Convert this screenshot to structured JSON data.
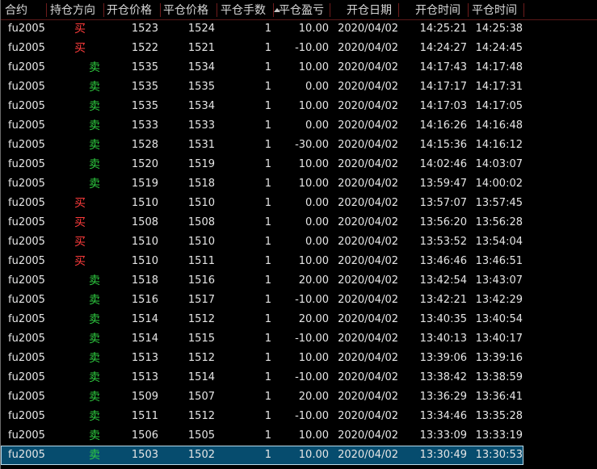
{
  "headers": {
    "contract": "合约",
    "direction": "持仓方向",
    "open_price": "开仓价格",
    "close_price": "平仓价格",
    "quantity": "平仓手数",
    "pnl": "平仓盈亏",
    "date": "开仓日期",
    "open_time": "开仓时间",
    "close_time": "平仓时间"
  },
  "colors": {
    "buy": "#ff3c3c",
    "sell": "#2ecc40",
    "selection": "#064c6e",
    "header_separator": "#6e1c1c"
  },
  "sort": {
    "column": "平仓盈亏",
    "icon": "sort-up-arrow-icon"
  },
  "rows": [
    {
      "contract": "fu2005",
      "direction": "买",
      "side": "buy",
      "open_price": "1523",
      "close_price": "1524",
      "quantity": "1",
      "pnl": "10.00",
      "date": "2020/04/02",
      "open_time": "14:25:21",
      "close_time": "14:25:38"
    },
    {
      "contract": "fu2005",
      "direction": "买",
      "side": "buy",
      "open_price": "1522",
      "close_price": "1521",
      "quantity": "1",
      "pnl": "-10.00",
      "date": "2020/04/02",
      "open_time": "14:24:27",
      "close_time": "14:24:45"
    },
    {
      "contract": "fu2005",
      "direction": "卖",
      "side": "sell",
      "open_price": "1535",
      "close_price": "1534",
      "quantity": "1",
      "pnl": "10.00",
      "date": "2020/04/02",
      "open_time": "14:17:43",
      "close_time": "14:17:48"
    },
    {
      "contract": "fu2005",
      "direction": "卖",
      "side": "sell",
      "open_price": "1535",
      "close_price": "1535",
      "quantity": "1",
      "pnl": "0.00",
      "date": "2020/04/02",
      "open_time": "14:17:17",
      "close_time": "14:17:31"
    },
    {
      "contract": "fu2005",
      "direction": "卖",
      "side": "sell",
      "open_price": "1535",
      "close_price": "1534",
      "quantity": "1",
      "pnl": "10.00",
      "date": "2020/04/02",
      "open_time": "14:17:03",
      "close_time": "14:17:05"
    },
    {
      "contract": "fu2005",
      "direction": "卖",
      "side": "sell",
      "open_price": "1533",
      "close_price": "1533",
      "quantity": "1",
      "pnl": "0.00",
      "date": "2020/04/02",
      "open_time": "14:16:26",
      "close_time": "14:16:48"
    },
    {
      "contract": "fu2005",
      "direction": "卖",
      "side": "sell",
      "open_price": "1528",
      "close_price": "1531",
      "quantity": "1",
      "pnl": "-30.00",
      "date": "2020/04/02",
      "open_time": "14:15:36",
      "close_time": "14:16:12"
    },
    {
      "contract": "fu2005",
      "direction": "卖",
      "side": "sell",
      "open_price": "1520",
      "close_price": "1519",
      "quantity": "1",
      "pnl": "10.00",
      "date": "2020/04/02",
      "open_time": "14:02:46",
      "close_time": "14:03:07"
    },
    {
      "contract": "fu2005",
      "direction": "卖",
      "side": "sell",
      "open_price": "1519",
      "close_price": "1518",
      "quantity": "1",
      "pnl": "10.00",
      "date": "2020/04/02",
      "open_time": "13:59:47",
      "close_time": "14:00:02"
    },
    {
      "contract": "fu2005",
      "direction": "买",
      "side": "buy",
      "open_price": "1510",
      "close_price": "1510",
      "quantity": "1",
      "pnl": "0.00",
      "date": "2020/04/02",
      "open_time": "13:57:07",
      "close_time": "13:57:45"
    },
    {
      "contract": "fu2005",
      "direction": "买",
      "side": "buy",
      "open_price": "1508",
      "close_price": "1508",
      "quantity": "1",
      "pnl": "0.00",
      "date": "2020/04/02",
      "open_time": "13:56:20",
      "close_time": "13:56:28"
    },
    {
      "contract": "fu2005",
      "direction": "买",
      "side": "buy",
      "open_price": "1510",
      "close_price": "1510",
      "quantity": "1",
      "pnl": "0.00",
      "date": "2020/04/02",
      "open_time": "13:53:52",
      "close_time": "13:54:04"
    },
    {
      "contract": "fu2005",
      "direction": "买",
      "side": "buy",
      "open_price": "1510",
      "close_price": "1511",
      "quantity": "1",
      "pnl": "10.00",
      "date": "2020/04/02",
      "open_time": "13:46:46",
      "close_time": "13:46:51"
    },
    {
      "contract": "fu2005",
      "direction": "卖",
      "side": "sell",
      "open_price": "1518",
      "close_price": "1516",
      "quantity": "1",
      "pnl": "20.00",
      "date": "2020/04/02",
      "open_time": "13:42:54",
      "close_time": "13:43:07"
    },
    {
      "contract": "fu2005",
      "direction": "卖",
      "side": "sell",
      "open_price": "1516",
      "close_price": "1517",
      "quantity": "1",
      "pnl": "-10.00",
      "date": "2020/04/02",
      "open_time": "13:42:21",
      "close_time": "13:42:29"
    },
    {
      "contract": "fu2005",
      "direction": "卖",
      "side": "sell",
      "open_price": "1514",
      "close_price": "1512",
      "quantity": "1",
      "pnl": "20.00",
      "date": "2020/04/02",
      "open_time": "13:40:35",
      "close_time": "13:40:54"
    },
    {
      "contract": "fu2005",
      "direction": "卖",
      "side": "sell",
      "open_price": "1514",
      "close_price": "1515",
      "quantity": "1",
      "pnl": "-10.00",
      "date": "2020/04/02",
      "open_time": "13:40:13",
      "close_time": "13:40:17"
    },
    {
      "contract": "fu2005",
      "direction": "卖",
      "side": "sell",
      "open_price": "1513",
      "close_price": "1512",
      "quantity": "1",
      "pnl": "10.00",
      "date": "2020/04/02",
      "open_time": "13:39:06",
      "close_time": "13:39:16"
    },
    {
      "contract": "fu2005",
      "direction": "卖",
      "side": "sell",
      "open_price": "1513",
      "close_price": "1514",
      "quantity": "1",
      "pnl": "-10.00",
      "date": "2020/04/02",
      "open_time": "13:38:42",
      "close_time": "13:38:59"
    },
    {
      "contract": "fu2005",
      "direction": "卖",
      "side": "sell",
      "open_price": "1509",
      "close_price": "1507",
      "quantity": "1",
      "pnl": "20.00",
      "date": "2020/04/02",
      "open_time": "13:36:29",
      "close_time": "13:36:41"
    },
    {
      "contract": "fu2005",
      "direction": "卖",
      "side": "sell",
      "open_price": "1511",
      "close_price": "1512",
      "quantity": "1",
      "pnl": "-10.00",
      "date": "2020/04/02",
      "open_time": "13:34:46",
      "close_time": "13:35:28"
    },
    {
      "contract": "fu2005",
      "direction": "卖",
      "side": "sell",
      "open_price": "1506",
      "close_price": "1505",
      "quantity": "1",
      "pnl": "10.00",
      "date": "2020/04/02",
      "open_time": "13:33:09",
      "close_time": "13:33:19"
    },
    {
      "contract": "fu2005",
      "direction": "卖",
      "side": "sell",
      "open_price": "1503",
      "close_price": "1502",
      "quantity": "1",
      "pnl": "10.00",
      "date": "2020/04/02",
      "open_time": "13:30:49",
      "close_time": "13:30:53",
      "selected": true
    }
  ]
}
